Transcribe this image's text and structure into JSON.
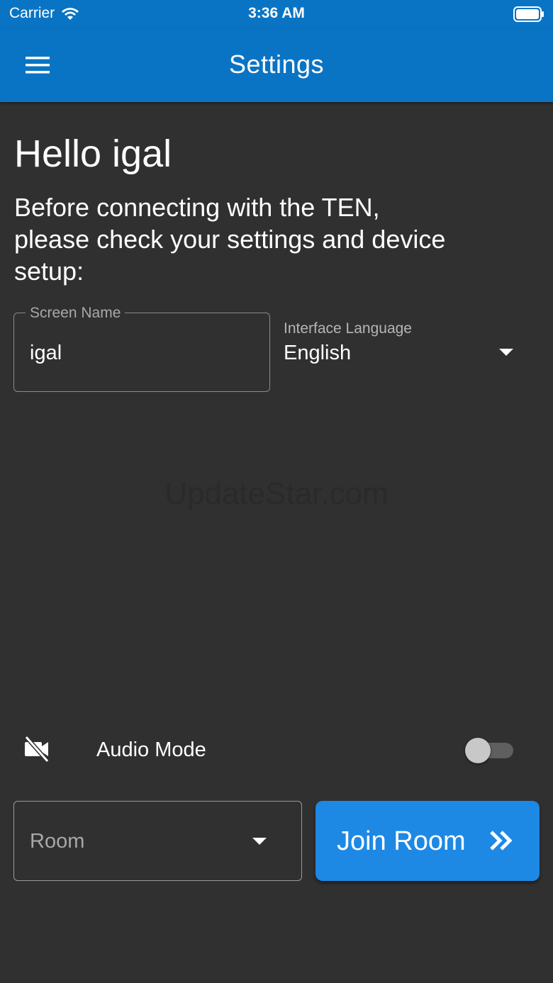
{
  "status_bar": {
    "carrier": "Carrier",
    "time": "3:36 AM"
  },
  "app_bar": {
    "title": "Settings"
  },
  "content": {
    "greeting": "Hello igal",
    "intro": "Before connecting with the TEN, please check your settings and device setup:",
    "screen_name": {
      "label": "Screen Name",
      "value": "igal"
    },
    "interface_language": {
      "label": "Interface Language",
      "value": "English"
    },
    "watermark": "UpdateStar.com"
  },
  "audio_mode": {
    "label": "Audio Mode",
    "enabled": false
  },
  "room": {
    "placeholder": "Room"
  },
  "join_button": {
    "label": "Join Room"
  },
  "colors": {
    "primary": "#0a74c4",
    "button": "#1e88e5",
    "background": "#303030"
  }
}
